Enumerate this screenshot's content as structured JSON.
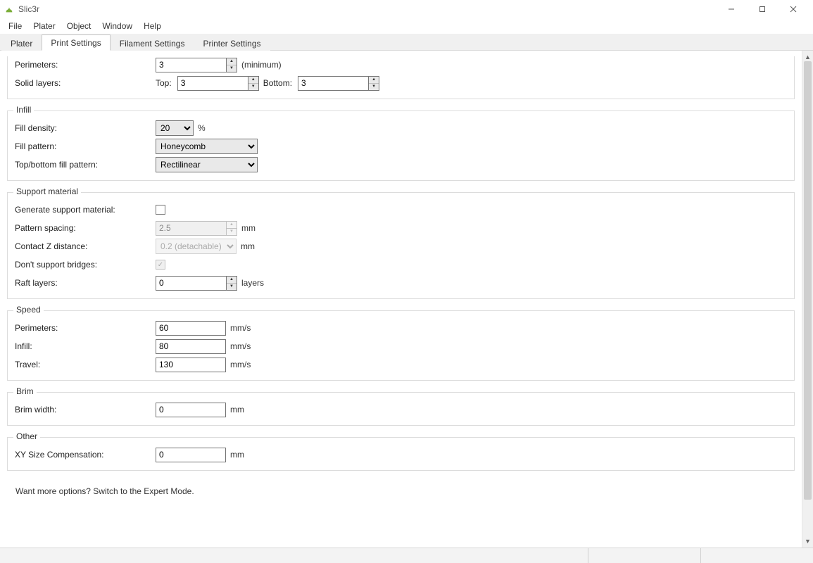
{
  "app": {
    "title": "Slic3r"
  },
  "menu": {
    "file": "File",
    "plater": "Plater",
    "object": "Object",
    "window": "Window",
    "help": "Help"
  },
  "tabs": {
    "plater": "Plater",
    "print_settings": "Print Settings",
    "filament_settings": "Filament Settings",
    "printer_settings": "Printer Settings"
  },
  "top_section": {
    "perimeters_label": "Perimeters:",
    "perimeters_value": "3",
    "perimeters_unit": "(minimum)",
    "solid_layers_label": "Solid layers:",
    "top_label": "Top:",
    "top_value": "3",
    "bottom_label": "Bottom:",
    "bottom_value": "3"
  },
  "infill": {
    "legend": "Infill",
    "fill_density_label": "Fill density:",
    "fill_density_value": "20",
    "fill_density_unit": "%",
    "fill_pattern_label": "Fill pattern:",
    "fill_pattern_value": "Honeycomb",
    "top_bottom_label": "Top/bottom fill pattern:",
    "top_bottom_value": "Rectilinear"
  },
  "support": {
    "legend": "Support material",
    "generate_label": "Generate support material:",
    "generate_checked": false,
    "pattern_spacing_label": "Pattern spacing:",
    "pattern_spacing_value": "2.5",
    "pattern_spacing_unit": "mm",
    "contact_z_label": "Contact Z distance:",
    "contact_z_value": "0.2 (detachable)",
    "contact_z_unit": "mm",
    "dont_support_bridges_label": "Don't support bridges:",
    "dont_support_bridges_checked": true,
    "raft_layers_label": "Raft layers:",
    "raft_layers_value": "0",
    "raft_layers_unit": "layers"
  },
  "speed": {
    "legend": "Speed",
    "perimeters_label": "Perimeters:",
    "perimeters_value": "60",
    "infill_label": "Infill:",
    "infill_value": "80",
    "travel_label": "Travel:",
    "travel_value": "130",
    "unit": "mm/s"
  },
  "brim": {
    "legend": "Brim",
    "width_label": "Brim width:",
    "width_value": "0",
    "unit": "mm"
  },
  "other": {
    "legend": "Other",
    "xy_comp_label": "XY Size Compensation:",
    "xy_comp_value": "0",
    "unit": "mm"
  },
  "footer": {
    "hint": "Want more options? Switch to the Expert Mode."
  }
}
